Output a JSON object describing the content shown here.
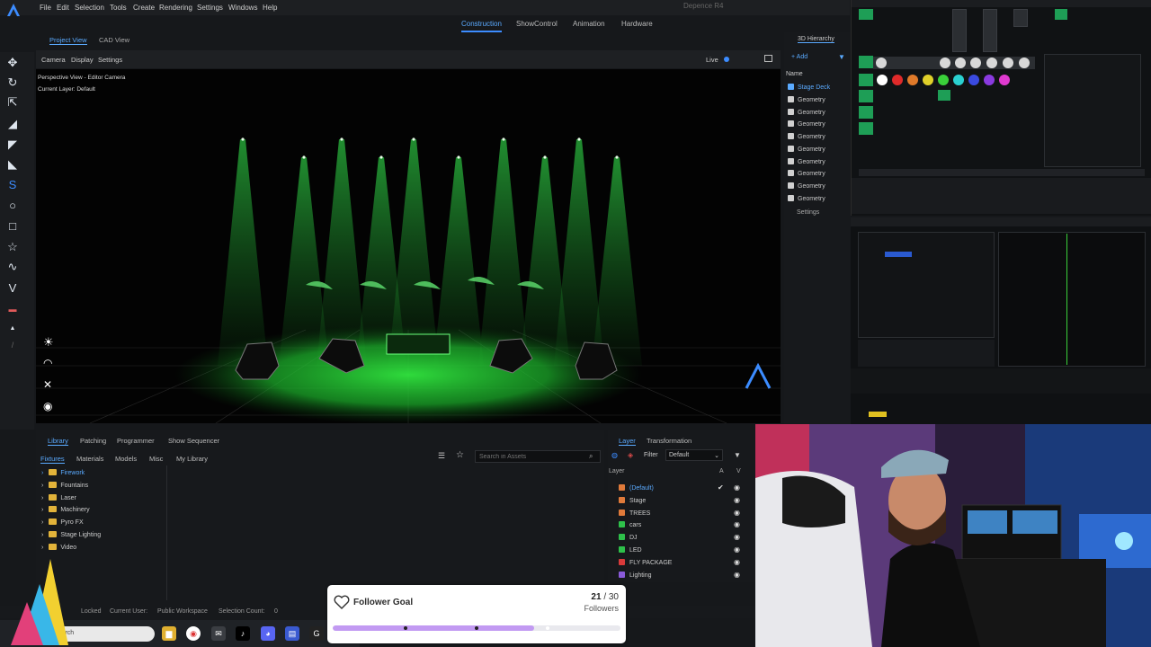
{
  "app": {
    "window_title": "Depence R4",
    "menu": [
      "File",
      "Edit",
      "Selection",
      "Tools",
      "Create",
      "Rendering",
      "Settings",
      "Windows",
      "Help"
    ],
    "workspace_tabs": [
      "Construction",
      "ShowControl",
      "Animation",
      "Hardware"
    ],
    "active_workspace": "Construction"
  },
  "viewport": {
    "tabs": [
      "Project View",
      "CAD View"
    ],
    "toolbar": [
      "Camera",
      "Display",
      "Settings"
    ],
    "live_label": "Live",
    "camera_label": "Perspective View - Editor Camera",
    "layer_label": "Current Layer: Default"
  },
  "hierarchy": {
    "title": "3D Hierarchy",
    "add_label": "+ Add",
    "column": "Name",
    "items": [
      "Stage Deck",
      "Geometry",
      "Geometry",
      "Geometry",
      "Geometry",
      "Geometry",
      "Geometry",
      "Geometry",
      "Geometry",
      "Geometry"
    ],
    "settings_label": "Settings"
  },
  "library": {
    "tabs": [
      "Library",
      "Patching",
      "Programmer",
      "Show Sequencer"
    ],
    "sub_tabs": [
      "Fixtures",
      "Materials",
      "Models",
      "Misc",
      "My Library"
    ],
    "search_placeholder": "Search in Assets",
    "folders": [
      "Firework",
      "Fountains",
      "Laser",
      "Machinery",
      "Pyro FX",
      "Stage Lighting",
      "Video"
    ]
  },
  "layers": {
    "tabs": [
      "Layer",
      "Transformation"
    ],
    "filter_label": "Filter",
    "filter_value": "Default",
    "column": "Layer",
    "col_a": "A",
    "col_v": "V",
    "items": [
      {
        "name": "(Default)",
        "color": "#e07a3a"
      },
      {
        "name": "Stage",
        "color": "#e07a3a"
      },
      {
        "name": "TREES",
        "color": "#e07a3a"
      },
      {
        "name": "cars",
        "color": "#2ec04a"
      },
      {
        "name": "DJ",
        "color": "#2ec04a"
      },
      {
        "name": "LED",
        "color": "#2ec04a"
      },
      {
        "name": "FLY PACKAGE",
        "color": "#d93a3a"
      },
      {
        "name": "Lighting",
        "color": "#8a5ad9"
      }
    ]
  },
  "status": {
    "locked": "Locked",
    "current_user": "Current User:",
    "workspace": "Public Workspace",
    "selection": "Selection Count:",
    "selection_count": "0"
  },
  "taskbar": {
    "search_placeholder": "Search"
  },
  "goal": {
    "title": "Follower Goal",
    "current": "21",
    "separator": "/",
    "target": "30",
    "unit": "Followers",
    "progress": 0.7
  },
  "colors": {
    "accent": "#3c8cff",
    "stage_green": "#27e03a"
  }
}
